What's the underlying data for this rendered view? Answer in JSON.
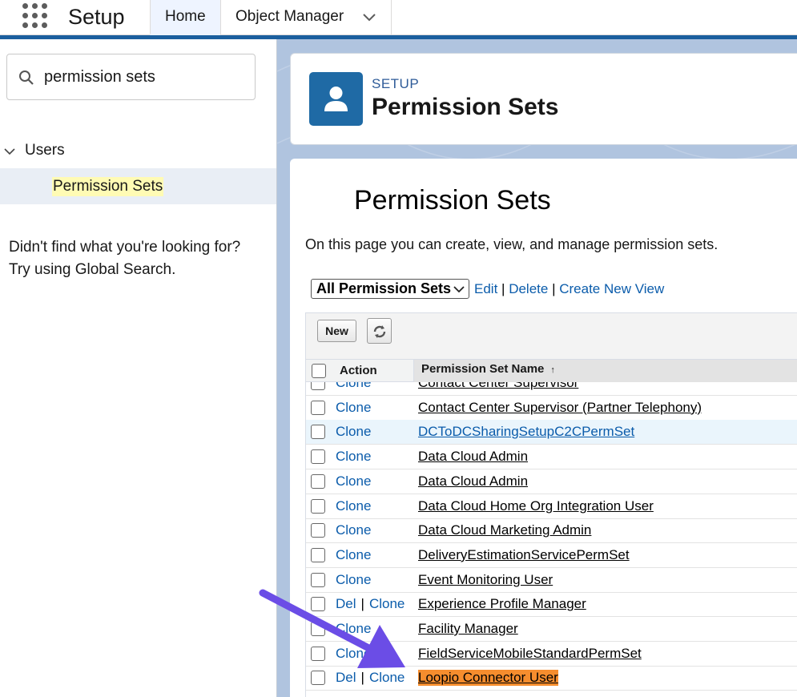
{
  "header": {
    "app_title": "Setup",
    "tabs": [
      "Home",
      "Object Manager"
    ]
  },
  "sidebar": {
    "search_value": "permission sets",
    "tree_parent": "Users",
    "tree_child": "Permission Sets",
    "not_found": "Didn't find what you're looking for? Try using Global Search."
  },
  "page_header": {
    "eyebrow": "SETUP",
    "title": "Permission Sets"
  },
  "content": {
    "heading": "Permission Sets",
    "description": "On this page you can create, view, and manage permission sets.",
    "view_selected": "All Permission Sets",
    "links": {
      "edit": "Edit",
      "delete": "Delete",
      "create": "Create New View"
    },
    "separator": "|",
    "new_button": "New",
    "columns": {
      "action": "Action",
      "name": "Permission Set Name",
      "sort": "↑"
    }
  },
  "rows": [
    {
      "del": "",
      "clone": "Clone",
      "name": "Contact Center Supervisor"
    },
    {
      "del": "",
      "clone": "Clone",
      "name": "Contact Center Supervisor (Partner Telephony)"
    },
    {
      "del": "",
      "clone": "Clone",
      "name": "DCToDCSharingSetupC2CPermSet"
    },
    {
      "del": "",
      "clone": "Clone",
      "name": "Data Cloud Admin"
    },
    {
      "del": "",
      "clone": "Clone",
      "name": "Data Cloud Admin"
    },
    {
      "del": "",
      "clone": "Clone",
      "name": "Data Cloud Home Org Integration User"
    },
    {
      "del": "",
      "clone": "Clone",
      "name": "Data Cloud Marketing Admin"
    },
    {
      "del": "",
      "clone": "Clone",
      "name": "DeliveryEstimationServicePermSet"
    },
    {
      "del": "",
      "clone": "Clone",
      "name": "Event Monitoring User"
    },
    {
      "del": "Del",
      "clone": "Clone",
      "name": "Experience Profile Manager"
    },
    {
      "del": "",
      "clone": "Clone",
      "name": "Facility Manager"
    },
    {
      "del": "",
      "clone": "Clone",
      "name": "FieldServiceMobileStandardPermSet"
    },
    {
      "del": "Del",
      "clone": "Clone",
      "name": "Loopio Connector User"
    }
  ],
  "colors": {
    "row_highlight": "#eaf5fc",
    "name_highlight": "#f68d2e",
    "arrow": "#6b4de6",
    "link": "#0b5cab"
  }
}
